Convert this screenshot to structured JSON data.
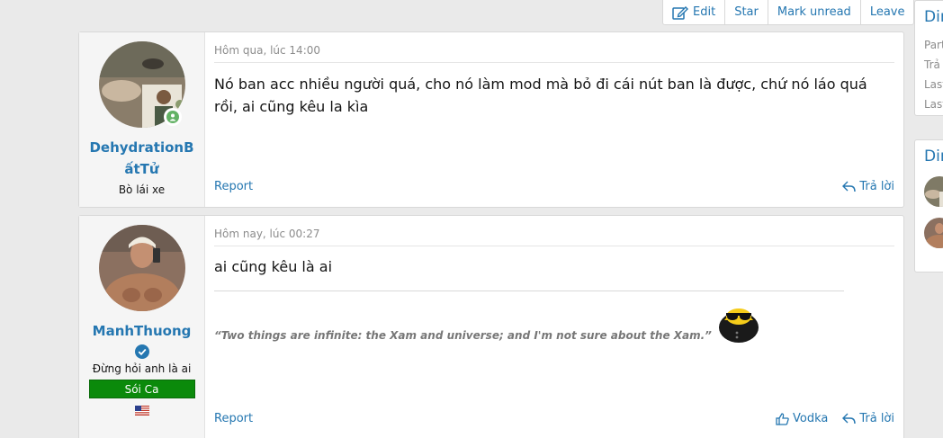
{
  "topbar": {
    "edit_label": "Edit",
    "star_label": "Star",
    "mark_unread_label": "Mark unread",
    "leave_label": "Leave"
  },
  "posts": [
    {
      "username": "DehydrationBấtTử",
      "user_title": "Bò lái xe",
      "date": "Hôm qua, lúc 14:00",
      "body": "Nó ban acc nhiều người quá, cho nó làm mod mà bỏ đi cái nút ban là được, chứ nó láo quá rồi, ai cũng kêu la kìa",
      "report_label": "Report",
      "reply_label": "Trả lời"
    },
    {
      "username": "ManhThuong",
      "user_title": "Đừng hỏi anh là ai",
      "banner": "Sói Ca",
      "date": "Hôm nay, lúc 00:27",
      "body": "ai cũng kêu là ai",
      "signature": "“Two things are infinite: the Xam and universe; and I'm not sure about the Xam.”",
      "report_label": "Report",
      "like_label": "Vodka",
      "reply_label": "Trả lời"
    }
  ],
  "sidebar": {
    "block1_title": "Dir",
    "block1_lines": [
      "Part",
      "Trả",
      "Last",
      "Last"
    ],
    "block2_title": "Dir"
  },
  "colors": {
    "accent": "#2577b1",
    "banner_bg": "#0b8a0b",
    "online": "#63b265"
  }
}
